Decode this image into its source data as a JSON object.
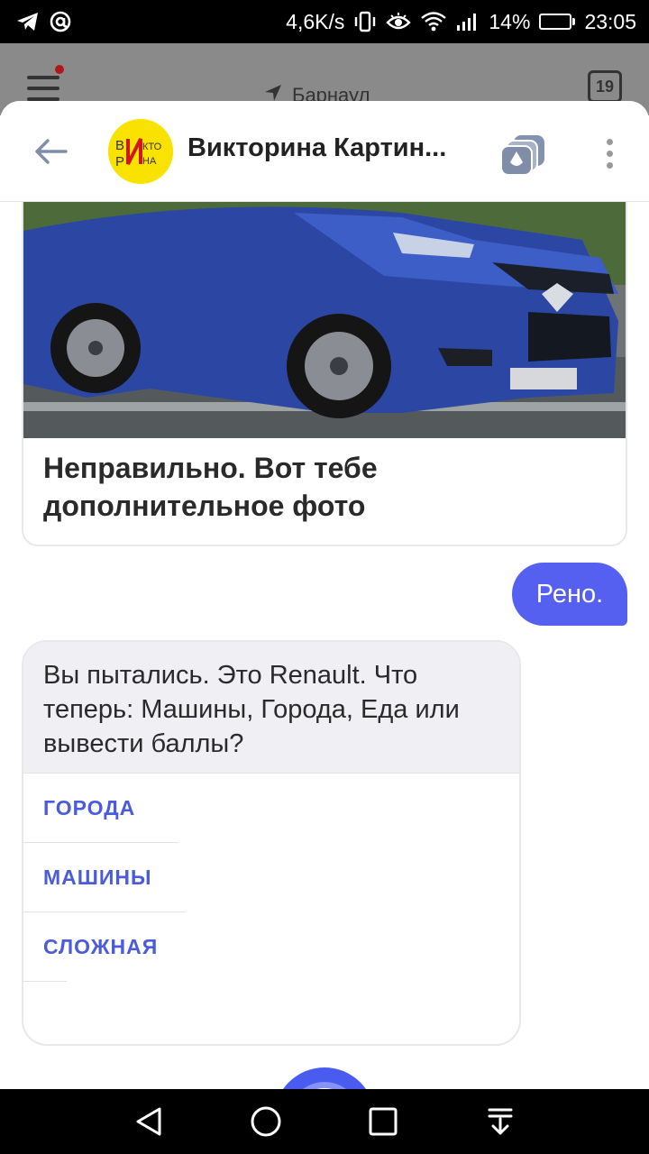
{
  "status_bar": {
    "network_speed": "4,6K/s",
    "battery": "14%",
    "battery_level": 0.14,
    "time": "23:05",
    "left_icons": [
      "telegram-icon",
      "at-sign-icon"
    ],
    "right_icons": [
      "vibrate-icon",
      "eye-icon",
      "wifi-icon",
      "signal-icon",
      "battery-icon"
    ]
  },
  "background_app": {
    "city": "Барнаул",
    "calendar_day": "19"
  },
  "header": {
    "title": "Викторина Картин...",
    "avatar_text": "ВИКТОРИНА",
    "colors": {
      "avatar_bg": "#f9e100"
    }
  },
  "chat": {
    "photo_card_text": "Неправильно. Вот тебе дополнительное фото",
    "user_message": "Рено.",
    "bot_message": "Вы пытались. Это Renault. Что теперь: Машины, Города, Еда или вывести баллы?",
    "suggestions": [
      "ГОРОДА",
      "МАШИНЫ",
      "СЛОЖНАЯ"
    ]
  },
  "colors": {
    "accent": "#4a5cf0",
    "user_bubble": "#5560f0",
    "suggest_text": "#4a5bdc"
  },
  "nav_bar": {
    "buttons": [
      "back-triangle-icon",
      "home-circle-icon",
      "recents-square-icon",
      "notifications-down-icon"
    ]
  }
}
